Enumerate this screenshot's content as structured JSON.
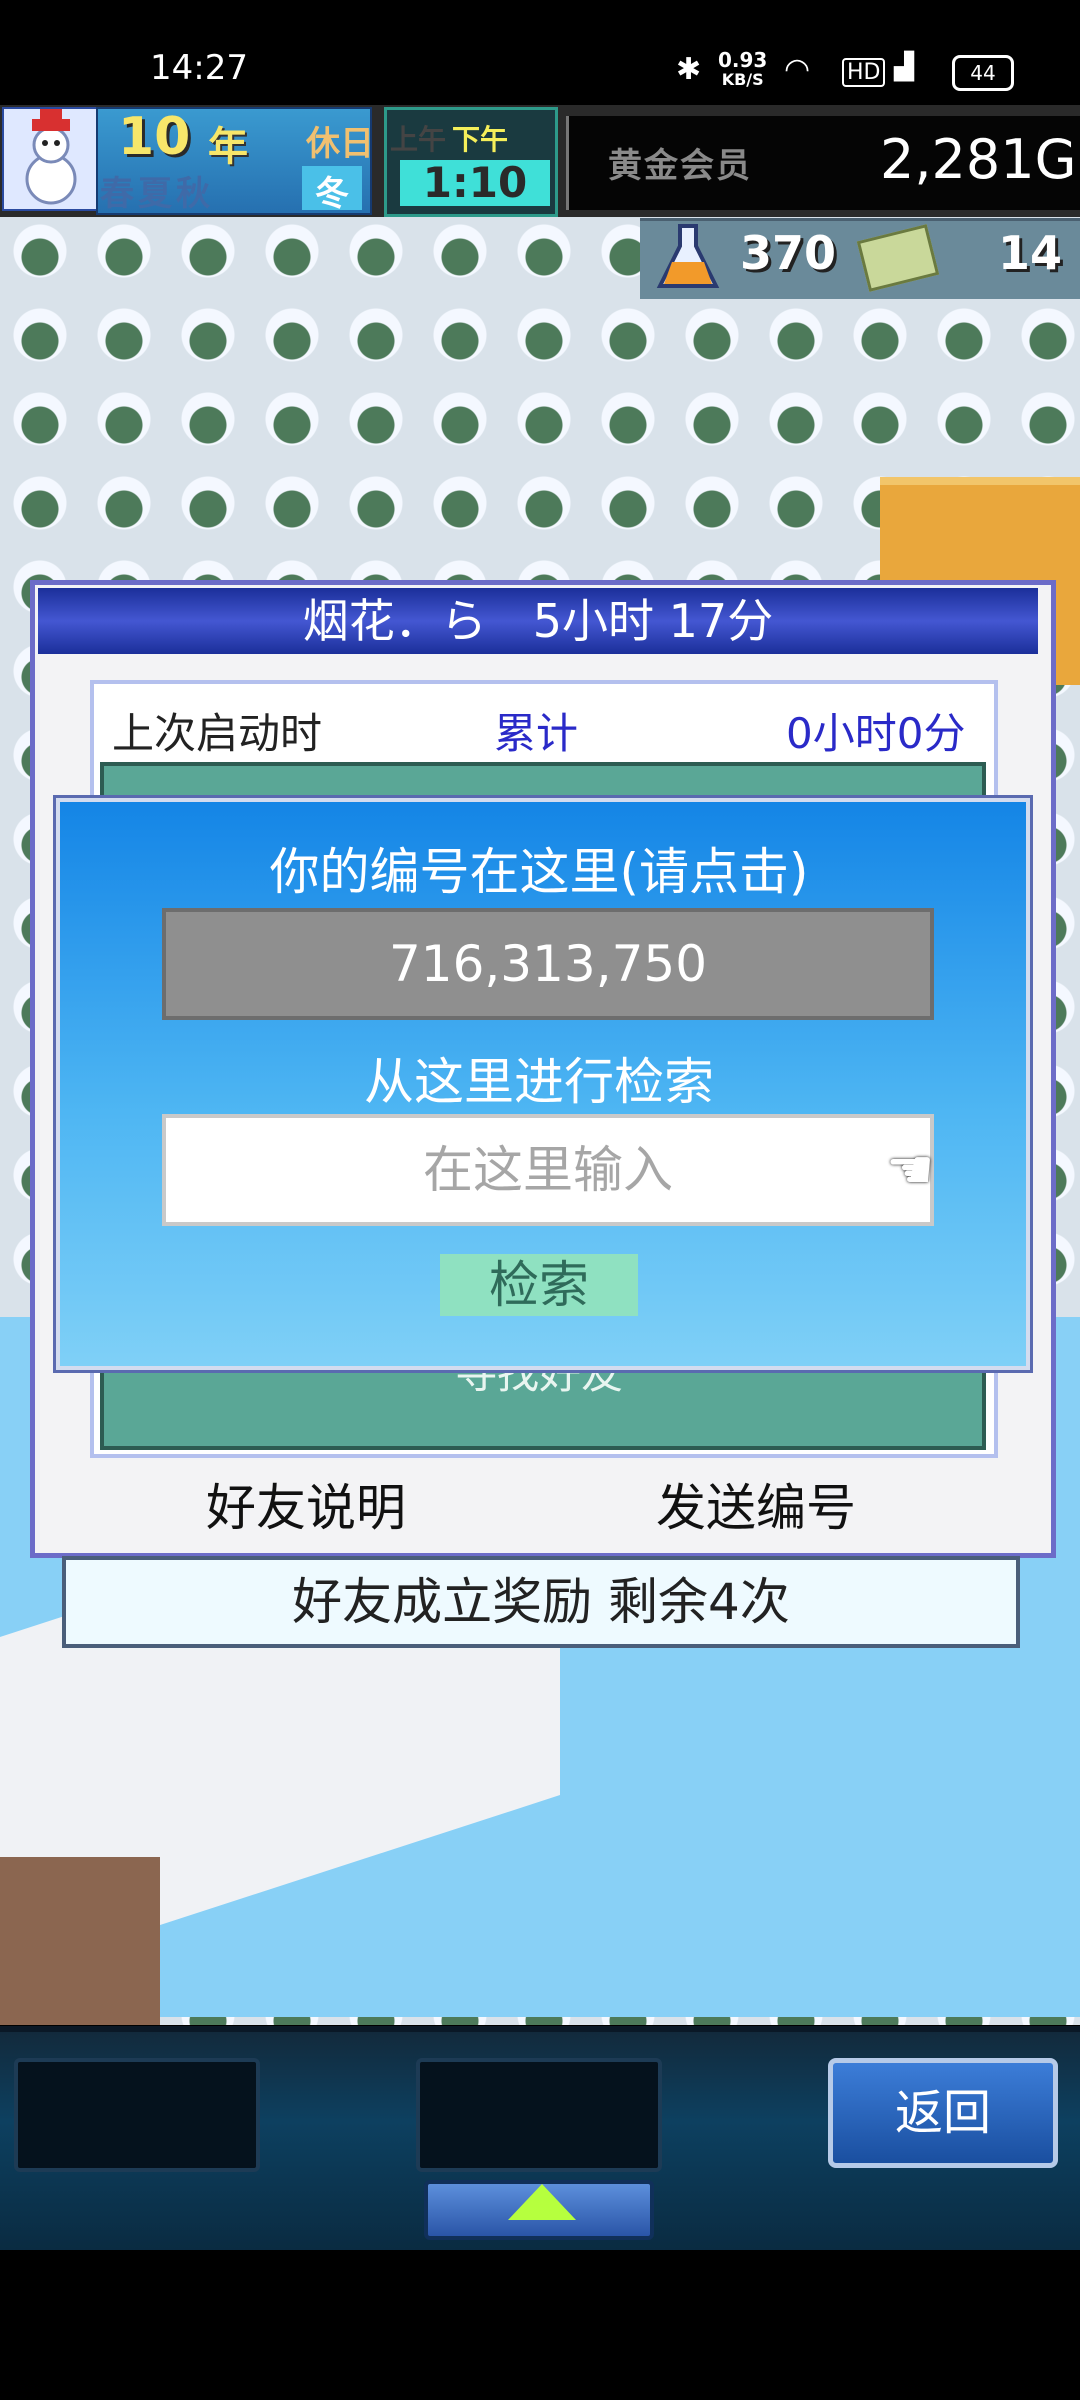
{
  "status_bar": {
    "time": "14:27",
    "net_speed_value": "0.93",
    "net_speed_unit": "KB/S",
    "battery": "44"
  },
  "hud": {
    "year_num": "10",
    "year_unit": "年",
    "rest_label": "休日",
    "seasons": "春夏秋",
    "season_current": "冬",
    "am_label": "上午",
    "pm_label": "下午",
    "clock": "1:10",
    "member_label": "黄金会员",
    "money": "2,281G",
    "research_points": "370",
    "tickets": "14"
  },
  "dialog": {
    "title": "烟花．ら　5小时 17分",
    "last_start_label": "上次启动时",
    "total_label": "累计",
    "total_value": "0小时0分",
    "find_friend_label": "寻找好友",
    "friend_help_label": "好友说明",
    "send_number_label": "发送编号"
  },
  "popup": {
    "title": "你的编号在这里(请点击)",
    "id_value": "716,313,750",
    "search_label": "从这里进行检索",
    "search_placeholder": "在这里输入",
    "search_button": "检索"
  },
  "reward_bar": "好友成立奖励  剩余4次",
  "bottom_bar": {
    "back_label": "返回"
  }
}
